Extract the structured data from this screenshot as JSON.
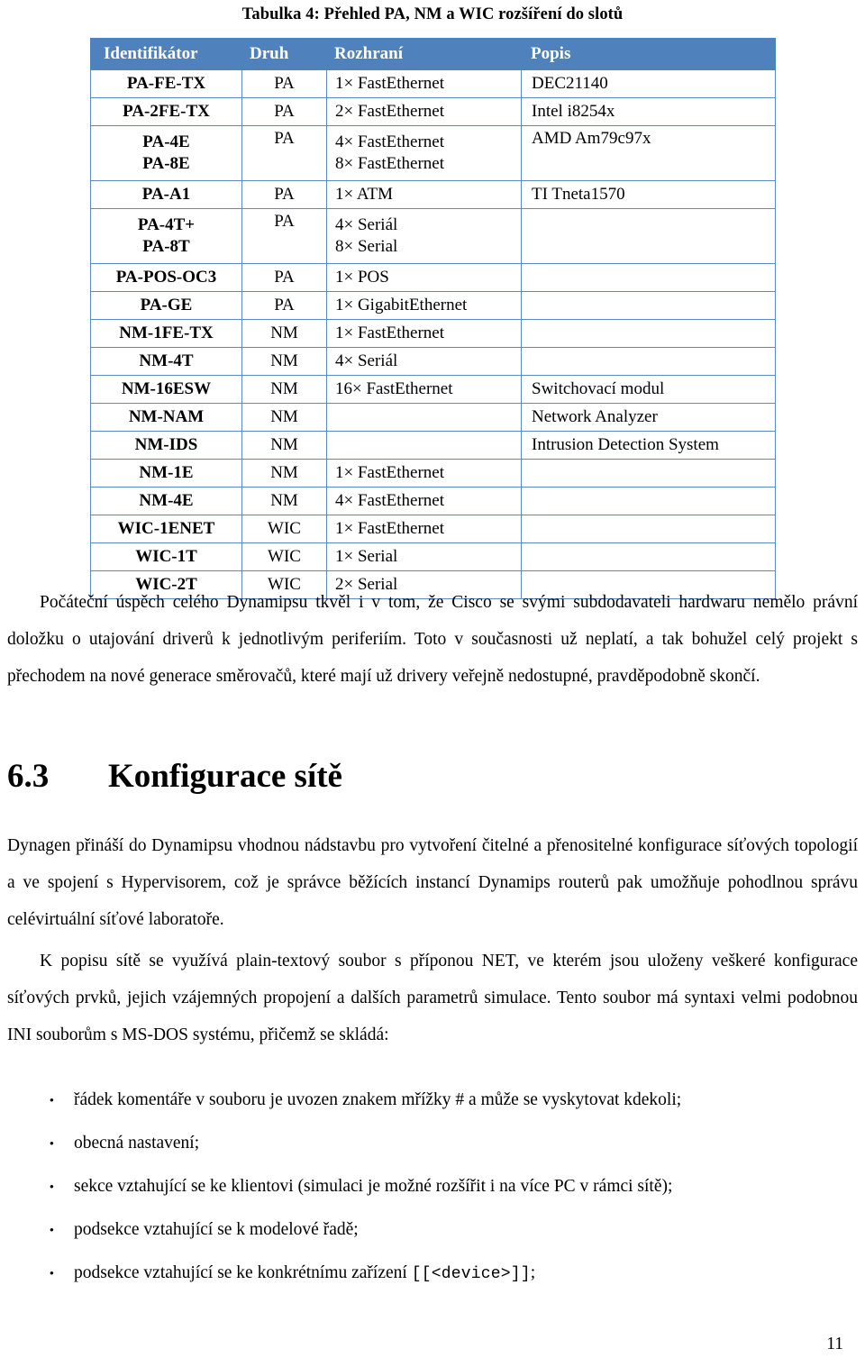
{
  "document": {
    "page_number": "11",
    "table_caption": "Tabulka 4: Přehled PA, NM a WIC rozšíření do slotů"
  },
  "table": {
    "accent_color": "#4F81BD",
    "border_color": "#5B8AC4",
    "header": {
      "identifikator": "Identifikátor",
      "druh": "Druh",
      "rozhrani": "Rozhraní",
      "popis": "Popis"
    },
    "rows": [
      {
        "id": "PA-FE-TX",
        "id2": "",
        "kind": "PA",
        "iface": "1× FastEthernet",
        "iface2": "",
        "desc": "DEC21140"
      },
      {
        "id": "PA-2FE-TX",
        "id2": "",
        "kind": "PA",
        "iface": "2× FastEthernet",
        "iface2": "",
        "desc": "Intel i8254x"
      },
      {
        "id": "PA-4E",
        "id2": "PA-8E",
        "kind": "PA",
        "iface": "4× FastEthernet",
        "iface2": "8× FastEthernet",
        "desc": "AMD Am79c97x"
      },
      {
        "id": "PA-A1",
        "id2": "",
        "kind": "PA",
        "iface": "1× ATM",
        "iface2": "",
        "desc": "TI Tneta1570"
      },
      {
        "id": "PA-4T+",
        "id2": "PA-8T",
        "kind": "PA",
        "iface": "4× Seriál",
        "iface2": "8× Serial",
        "desc": ""
      },
      {
        "id": "PA-POS-OC3",
        "id2": "",
        "kind": "PA",
        "iface": "1× POS",
        "iface2": "",
        "desc": ""
      },
      {
        "id": "PA-GE",
        "id2": "",
        "kind": "PA",
        "iface": "1× GigabitEthernet",
        "iface2": "",
        "desc": ""
      },
      {
        "id": "NM-1FE-TX",
        "id2": "",
        "kind": "NM",
        "iface": "1× FastEthernet",
        "iface2": "",
        "desc": ""
      },
      {
        "id": "NM-4T",
        "id2": "",
        "kind": "NM",
        "iface": "4× Seriál",
        "iface2": "",
        "desc": ""
      },
      {
        "id": "NM-16ESW",
        "id2": "",
        "kind": "NM",
        "iface": "16× FastEthernet",
        "iface2": "",
        "desc": "Switchovací modul"
      },
      {
        "id": "NM-NAM",
        "id2": "",
        "kind": "NM",
        "iface": "",
        "iface2": "",
        "desc": "Network Analyzer"
      },
      {
        "id": "NM-IDS",
        "id2": "",
        "kind": "NM",
        "iface": "",
        "iface2": "",
        "desc": "Intrusion Detection System"
      },
      {
        "id": "NM-1E",
        "id2": "",
        "kind": "NM",
        "iface": "1× FastEthernet",
        "iface2": "",
        "desc": ""
      },
      {
        "id": "NM-4E",
        "id2": "",
        "kind": "NM",
        "iface": "4× FastEthernet",
        "iface2": "",
        "desc": ""
      },
      {
        "id": "WIC-1ENET",
        "id2": "",
        "kind": "WIC",
        "iface": "1× FastEthernet",
        "iface2": "",
        "desc": ""
      },
      {
        "id": "WIC-1T",
        "id2": "",
        "kind": "WIC",
        "iface": "1× Serial",
        "iface2": "",
        "desc": ""
      },
      {
        "id": "WIC-2T",
        "id2": "",
        "kind": "WIC",
        "iface": "2× Serial",
        "iface2": "",
        "desc": ""
      }
    ]
  },
  "body": {
    "paragraph_intro": "Počáteční úspěch celého Dynamipsu tkvěl i v tom, že Cisco se svými subdodavateli hardwaru nemělo právní doložku o utajování driverů k jednotlivým periferiím. Toto v současnosti už neplatí, a tak bohužel celý projekt s přechodem na nové generace směrovačů, které mají už drivery veřejně nedostupné, pravděpodobně skončí.",
    "heading_number": "6.3",
    "heading_title": "Konfigurace sítě",
    "paragraph_dynagen": "Dynagen přináší do Dynamipsu vhodnou nádstavbu pro vytvoření čitelné a přenositelné konfigurace síťových topologií a ve spojení s Hypervisorem, což je správce běžících instancí Dynamips routerů pak umožňuje pohodlnou správu celévirtuální síťové laboratoře.",
    "paragraph_netfile": "K popisu sítě se využívá plain-textový soubor s příponou NET, ve kterém jsou uloženy veškeré konfigurace síťových prvků, jejich vzájemných propojení a dalších parametrů simulace. Tento soubor má syntaxi velmi podobnou INI souborům s MS-DOS systému, přičemž se skládá:",
    "bullet_marker": "•",
    "bullets": [
      {
        "text": "řádek komentáře v souboru je uvozen znakem mřížky # a může se vyskytovat kdekoli;",
        "code": "",
        "tail": ""
      },
      {
        "text": "obecná nastavení;",
        "code": "",
        "tail": ""
      },
      {
        "text": "sekce vztahující se ke klientovi (simulaci je možné rozšířit i na více PC v rámci sítě);",
        "code": "",
        "tail": ""
      },
      {
        "text": "podsekce vztahující se k modelové řadě;",
        "code": "",
        "tail": ""
      },
      {
        "text": "podsekce vztahující se ke konkrétnímu zařízení ",
        "code": "[[<device>]]",
        "tail": ";"
      }
    ]
  }
}
